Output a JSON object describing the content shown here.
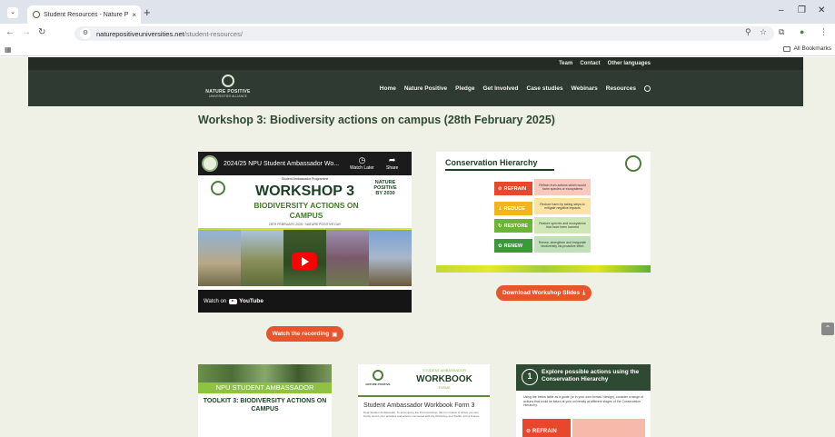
{
  "browser": {
    "tab_title": "Student Resources - Nature Po",
    "tab_close": "×",
    "new_tab": "+",
    "url_host": "naturepositiveuniversities.net",
    "url_path": "/student-resources/",
    "minimize": "–",
    "restore": "❐",
    "close": "✕",
    "all_bookmarks": "All Bookmarks"
  },
  "site": {
    "topbar_links": [
      "Team",
      "Contact",
      "Other languages"
    ],
    "logo_name": "NATURE POSITIVE",
    "logo_sub": "UNIVERSITIES ALLIANCE",
    "nav": [
      "Home",
      "Nature Positive",
      "Pledge",
      "Get Involved",
      "Case studies",
      "Webinars",
      "Resources"
    ]
  },
  "main": {
    "heading": "Workshop 3: Biodiversity actions on campus (28th February 2025)",
    "video": {
      "title": "2024/25 NPU Student Ambassador Wo...",
      "watch_later": "Watch Later",
      "share": "Share",
      "programme": "Student Ambassador Programme",
      "workshop": "WORKSHOP 3",
      "subtitle": "BIODIVERSITY ACTIONS ON CAMPUS",
      "date": "28TH FEBRUARY 2025 · NATURE POSITIVE DAY",
      "nature": "NATURE POSITIVE BY 2030",
      "watch_on": "Watch on",
      "youtube": "YouTube"
    },
    "watch_button": "Watch the recording",
    "slide": {
      "title": "Conservation Hierarchy",
      "steps": [
        {
          "label": "REFRAIN",
          "note": "Refrain from actions which would harm species or ecosystems",
          "color": "#e8472b",
          "icon": "⊘"
        },
        {
          "label": "REDUCE",
          "note": "Reduce harm by taking steps to mitigate negative impacts",
          "color": "#f2b51e",
          "icon": "⇣"
        },
        {
          "label": "RESTORE",
          "note": "Restore species and ecosystems that have been harmed",
          "color": "#6bb535",
          "icon": "↻"
        },
        {
          "label": "RENEW",
          "note": "Renew, strengthen and invigorate biodiversity via proactive effort",
          "color": "#3a9a3a",
          "icon": "✿"
        }
      ]
    },
    "download_button": "Download Workshop Slides",
    "cards": {
      "toolkit_band": "NPU STUDENT AMBASSADOR",
      "toolkit_title": "TOOLKIT 3: BIODIVERSITY ACTIONS ON CAMPUS",
      "workbook_sa": "STUDENT AMBASSADOR",
      "workbook_title": "WORKBOOK",
      "workbook_forms": "FORMS",
      "workbook_logo": "NATURE POSITIVE",
      "workbook_form": "Student Ambassador Workbook Form 3",
      "workbook_body": "Dear Student Ambassador, To accompany the third workshop, this form below is where you can briefly record your activities and actions connected with the Workshop and Toolkit, and a chance",
      "explore_num": "1",
      "explore_title": "Explore possible actions using the Conservation Hierarchy",
      "explore_body": "Using the below table as a guide (or in your own format / design), consider a range of actions that could be taken at your university at different stages of the Conservation Hierarchy.",
      "explore_refrain": "REFRAIN"
    }
  }
}
